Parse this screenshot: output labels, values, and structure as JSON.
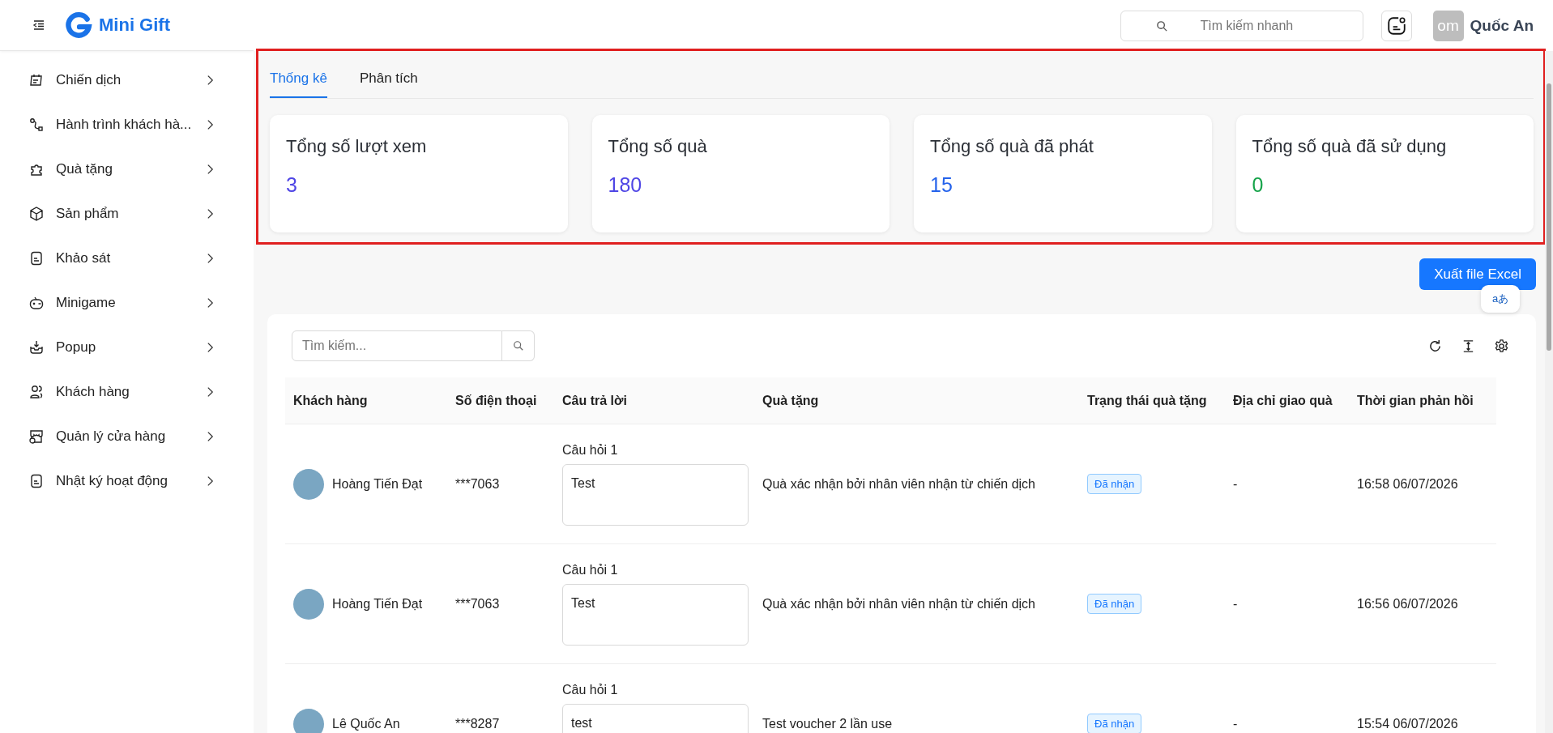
{
  "header": {
    "logo_text": "Mini Gift",
    "search_placeholder": "Tìm kiếm nhanh",
    "avatar_text": "om",
    "user_name": "Quốc An"
  },
  "sidebar": {
    "items": [
      {
        "label": "Chiến dịch"
      },
      {
        "label": "Hành trình khách hà..."
      },
      {
        "label": "Quà tặng"
      },
      {
        "label": "Sản phẩm"
      },
      {
        "label": "Khảo sát"
      },
      {
        "label": "Minigame"
      },
      {
        "label": "Popup"
      },
      {
        "label": "Khách hàng"
      },
      {
        "label": "Quản lý cửa hàng"
      },
      {
        "label": "Nhật ký hoạt động"
      }
    ]
  },
  "tabs": [
    {
      "label": "Thống kê",
      "selected": true
    },
    {
      "label": "Phân tích",
      "selected": false
    }
  ],
  "stats": [
    {
      "title": "Tổng số lượt xem",
      "value": "3",
      "color": "#4f46e5"
    },
    {
      "title": "Tổng số quà",
      "value": "180",
      "color": "#4f46e5"
    },
    {
      "title": "Tổng số quà đã phát",
      "value": "15",
      "color": "#2563eb"
    },
    {
      "title": "Tổng số quà đã sử dụng",
      "value": "0",
      "color": "#16a34a"
    }
  ],
  "export_button": "Xuất file Excel",
  "translate_badge": "aあ",
  "table": {
    "search_placeholder": "Tìm kiếm...",
    "columns": [
      "Khách hàng",
      "Số điện thoại",
      "Câu trả lời",
      "Quà tặng",
      "Trạng thái quà tặng",
      "Địa chỉ giao quà",
      "Thời gian phản hồi"
    ],
    "rows": [
      {
        "customer": "Hoàng Tiến Đạt",
        "phone": "***7063",
        "question": "Câu hỏi 1",
        "answer": "Test",
        "gift": "Quà xác nhận bởi nhân viên nhận từ chiến dịch",
        "status": "Đã nhận",
        "address": "-",
        "time": "16:58 06/07/2026"
      },
      {
        "customer": "Hoàng Tiến Đạt",
        "phone": "***7063",
        "question": "Câu hỏi 1",
        "answer": "Test",
        "gift": "Quà xác nhận bởi nhân viên nhận từ chiến dịch",
        "status": "Đã nhận",
        "address": "-",
        "time": "16:56 06/07/2026"
      },
      {
        "customer": "Lê Quốc An",
        "phone": "***8287",
        "question": "Câu hỏi 1",
        "answer": "test",
        "gift": "Test voucher 2 lần use",
        "status": "Đã nhận",
        "address": "-",
        "time": "15:54 06/07/2026"
      }
    ]
  }
}
